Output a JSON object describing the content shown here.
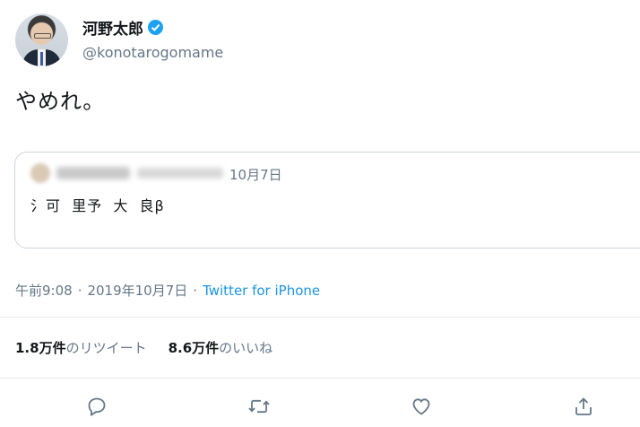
{
  "tweet": {
    "display_name": "河野太郎",
    "handle": "@konotarogomame",
    "text": "やめれ。",
    "verified_color": "#1da1f2"
  },
  "quoted_tweet": {
    "date": "10月7日",
    "text": "氵可  里予  大  良β"
  },
  "meta": {
    "time": "午前9:08",
    "separator1": "·",
    "date": "2019年10月7日",
    "separator2": "·",
    "source": "Twitter for iPhone"
  },
  "stats": {
    "retweets_count": "1.8万件",
    "retweets_label": "のリツイート",
    "likes_count": "8.6万件",
    "likes_label": "のいいね"
  },
  "actions": [
    "reply-icon",
    "retweet-icon",
    "like-icon",
    "share-icon"
  ]
}
